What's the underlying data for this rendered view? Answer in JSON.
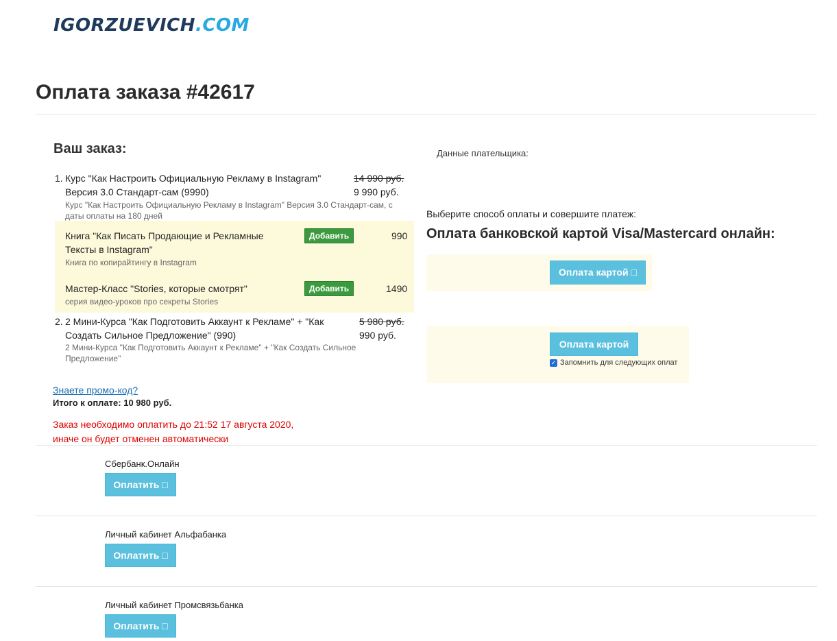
{
  "logo": {
    "main": "IGORZUEVICH",
    "suffix": ".COM"
  },
  "page_title": "Оплата заказа #42617",
  "order": {
    "title": "Ваш заказ:",
    "items": [
      {
        "num": "1.",
        "name_line1": "Курс \"Как Настроить Официальную Рекламу в Instagram\"",
        "name_line2": "Версия 3.0 Стандарт-сам (9990)",
        "old_price": "14 990 руб.",
        "price": "9 990 руб.",
        "desc_line1": "Курс \"Как Настроить Официальную Рекламу в Instagram\" Версия 3.0 Стандарт-сам, с",
        "desc_line2": "даты оплаты на 180 дней"
      },
      {
        "num": "2.",
        "name_line1": "2 Мини-Курса \"Как Подготовить Аккаунт к Рекламе\" + \"Как",
        "name_line2": "Создать Сильное Предложение\" (990)",
        "old_price": "5 980 руб.",
        "price": "990 руб.",
        "desc_line1": "2 Мини-Курса \"Как Подготовить Аккаунт к Рекламе\" + \"Как Создать Сильное",
        "desc_line2": "Предложение\""
      }
    ],
    "upsells": [
      {
        "name_line1": "Книга \"Как Писать Продающие и Рекламные",
        "name_line2": "Тексты в Instagram\"",
        "desc": "Книга по копирайтингу в Instagram",
        "button": "Добавить",
        "price": "990"
      },
      {
        "name_line1": "Мастер-Класс \"Stories, которые смотрят\"",
        "desc": "серия видео-уроков про секреты Stories",
        "button": "Добавить",
        "price": "1490"
      }
    ],
    "promo_link": "Знаете промо-код?",
    "total": "Итого к оплате: 10 980 руб.",
    "warning_line1": "Заказ необходимо оплатить до 21:52 17 августа 2020,",
    "warning_line2": "иначе он будет отменен автоматически"
  },
  "payment": {
    "payer_label": "Данные плательщика:",
    "choose_label": "Выберите способ оплаты и совершите платеж:",
    "card_title": "Оплата банковской картой Visa/Mastercard онлайн:",
    "card_button_1": "Оплата картой □",
    "card_button_2": "Оплата картой",
    "remember_label": "Запомнить для следующих оплат",
    "remember_checked": true
  },
  "banks": [
    {
      "name": "Сбербанк.Онлайн",
      "button": "Оплатить □"
    },
    {
      "name": "Личный кабинет Альфабанка",
      "button": "Оплатить □"
    },
    {
      "name": "Личный кабинет Промсвязьбанка",
      "button": "Оплатить □"
    }
  ],
  "colors": {
    "accent_blue": "#5bc0de",
    "add_green": "#3b9a3f",
    "warning_red": "#e00000",
    "link_blue": "#1a6fb5"
  }
}
